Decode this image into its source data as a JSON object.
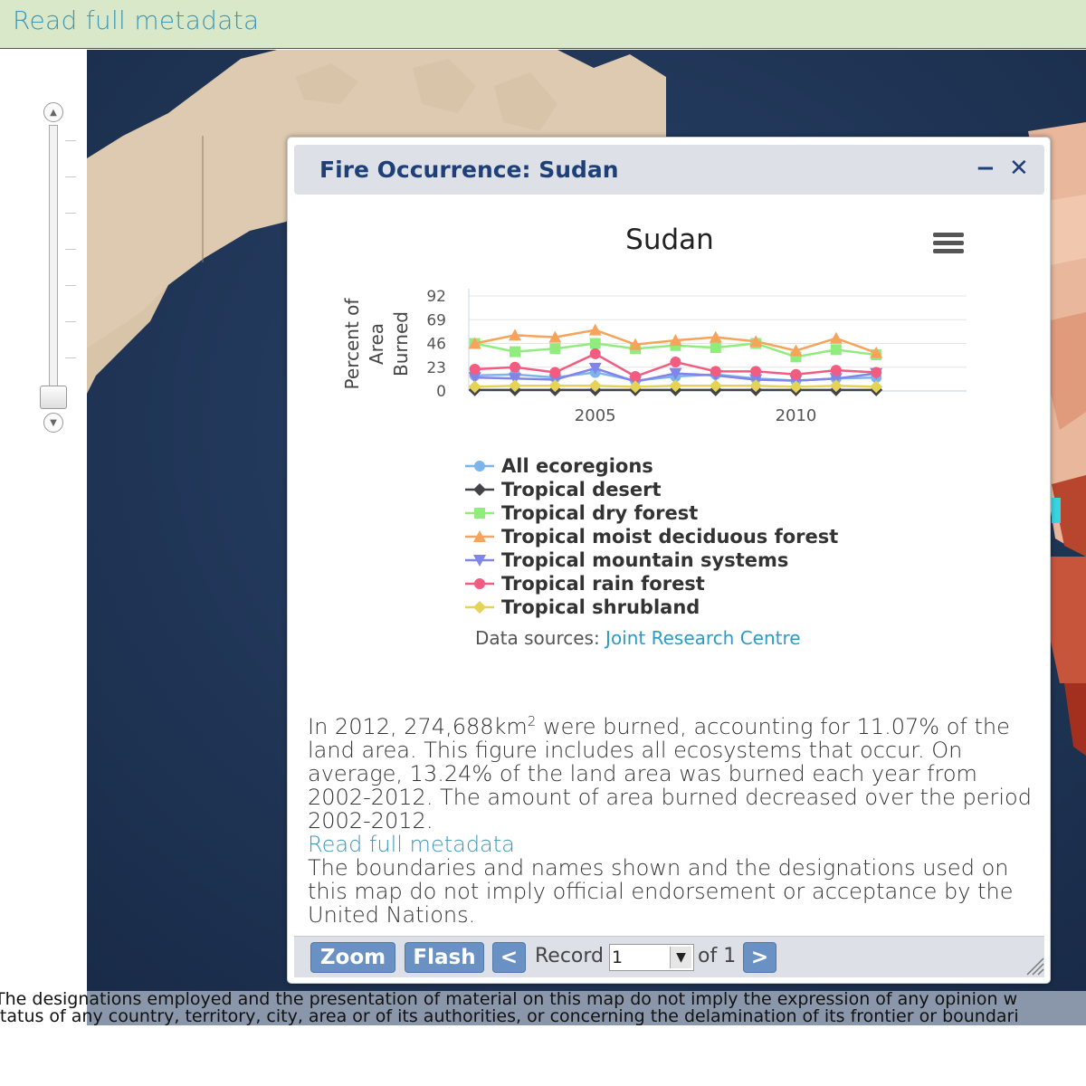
{
  "top_bar": {
    "link": "Read full metadata"
  },
  "popup": {
    "title": "Fire Occurrence: Sudan",
    "minimize_icon": "minus-icon",
    "close_icon": "close-icon"
  },
  "chart_data": {
    "type": "line",
    "title": "Sudan",
    "ylabel": "Percent of Area Burned",
    "xlabel": "",
    "x": [
      2002,
      2003,
      2004,
      2005,
      2006,
      2007,
      2008,
      2009,
      2010,
      2011,
      2012
    ],
    "xticks": [
      "2005",
      "2010"
    ],
    "yticks": [
      "92",
      "69",
      "46",
      "23",
      "0"
    ],
    "ylim": [
      0,
      92
    ],
    "series": [
      {
        "name": "All ecoregions",
        "color": "#7cb5ec",
        "marker": "circle",
        "values": [
          15,
          16,
          13,
          18,
          10,
          14,
          16,
          12,
          10,
          12,
          13
        ]
      },
      {
        "name": "Tropical desert",
        "color": "#434348",
        "marker": "diamond",
        "values": [
          1,
          1,
          1,
          1,
          1,
          1,
          1,
          1,
          1,
          1,
          1
        ]
      },
      {
        "name": "Tropical dry forest",
        "color": "#90ed7d",
        "marker": "square",
        "values": [
          46,
          38,
          41,
          46,
          41,
          44,
          42,
          46,
          33,
          40,
          35
        ]
      },
      {
        "name": "Tropical moist deciduous forest",
        "color": "#f7a35c",
        "marker": "triangle",
        "values": [
          46,
          54,
          52,
          59,
          45,
          49,
          52,
          48,
          39,
          51,
          37
        ]
      },
      {
        "name": "Tropical mountain systems",
        "color": "#8085e9",
        "marker": "triangle-down",
        "values": [
          13,
          12,
          11,
          22,
          9,
          17,
          15,
          11,
          10,
          12,
          17
        ]
      },
      {
        "name": "Tropical rain forest",
        "color": "#f15c80",
        "marker": "circle",
        "values": [
          21,
          23,
          18,
          36,
          14,
          28,
          19,
          19,
          16,
          20,
          18
        ]
      },
      {
        "name": "Tropical shrubland",
        "color": "#e4d354",
        "marker": "diamond",
        "values": [
          4,
          5,
          5,
          5,
          4,
          5,
          5,
          5,
          4,
          5,
          4
        ]
      }
    ],
    "legend_position": "bottom",
    "grid": true
  },
  "sources": {
    "label": "Data sources:",
    "link": "Joint Research Centre"
  },
  "summary": {
    "line_a": "In 2012, 274,688km",
    "sup": "2",
    "line_b": " were burned, accounting for 11.07% of the land area. This figure includes all ecosystems that occur. On average, 13.24% of the land area was burned each year from 2002-2012. The amount of area burned decreased over the period 2002-2012.",
    "meta_link": "Read full metadata",
    "disclaimer": "The boundaries and names shown and the designations used on this map do not imply official endorsement or acceptance by the United Nations."
  },
  "footer": {
    "zoom": "Zoom",
    "flash": "Flash",
    "prev": "<",
    "record_label": "Record",
    "record_value": "1",
    "of": "of 1",
    "next": ">"
  },
  "page_disclaimer": {
    "line1": "The designations employed and the presentation of material on this map do not imply the expression of any opinion w",
    "line2": "status of any country, territory, city, area or of its authorities, or concerning the delamination of its frontier or boundari"
  }
}
